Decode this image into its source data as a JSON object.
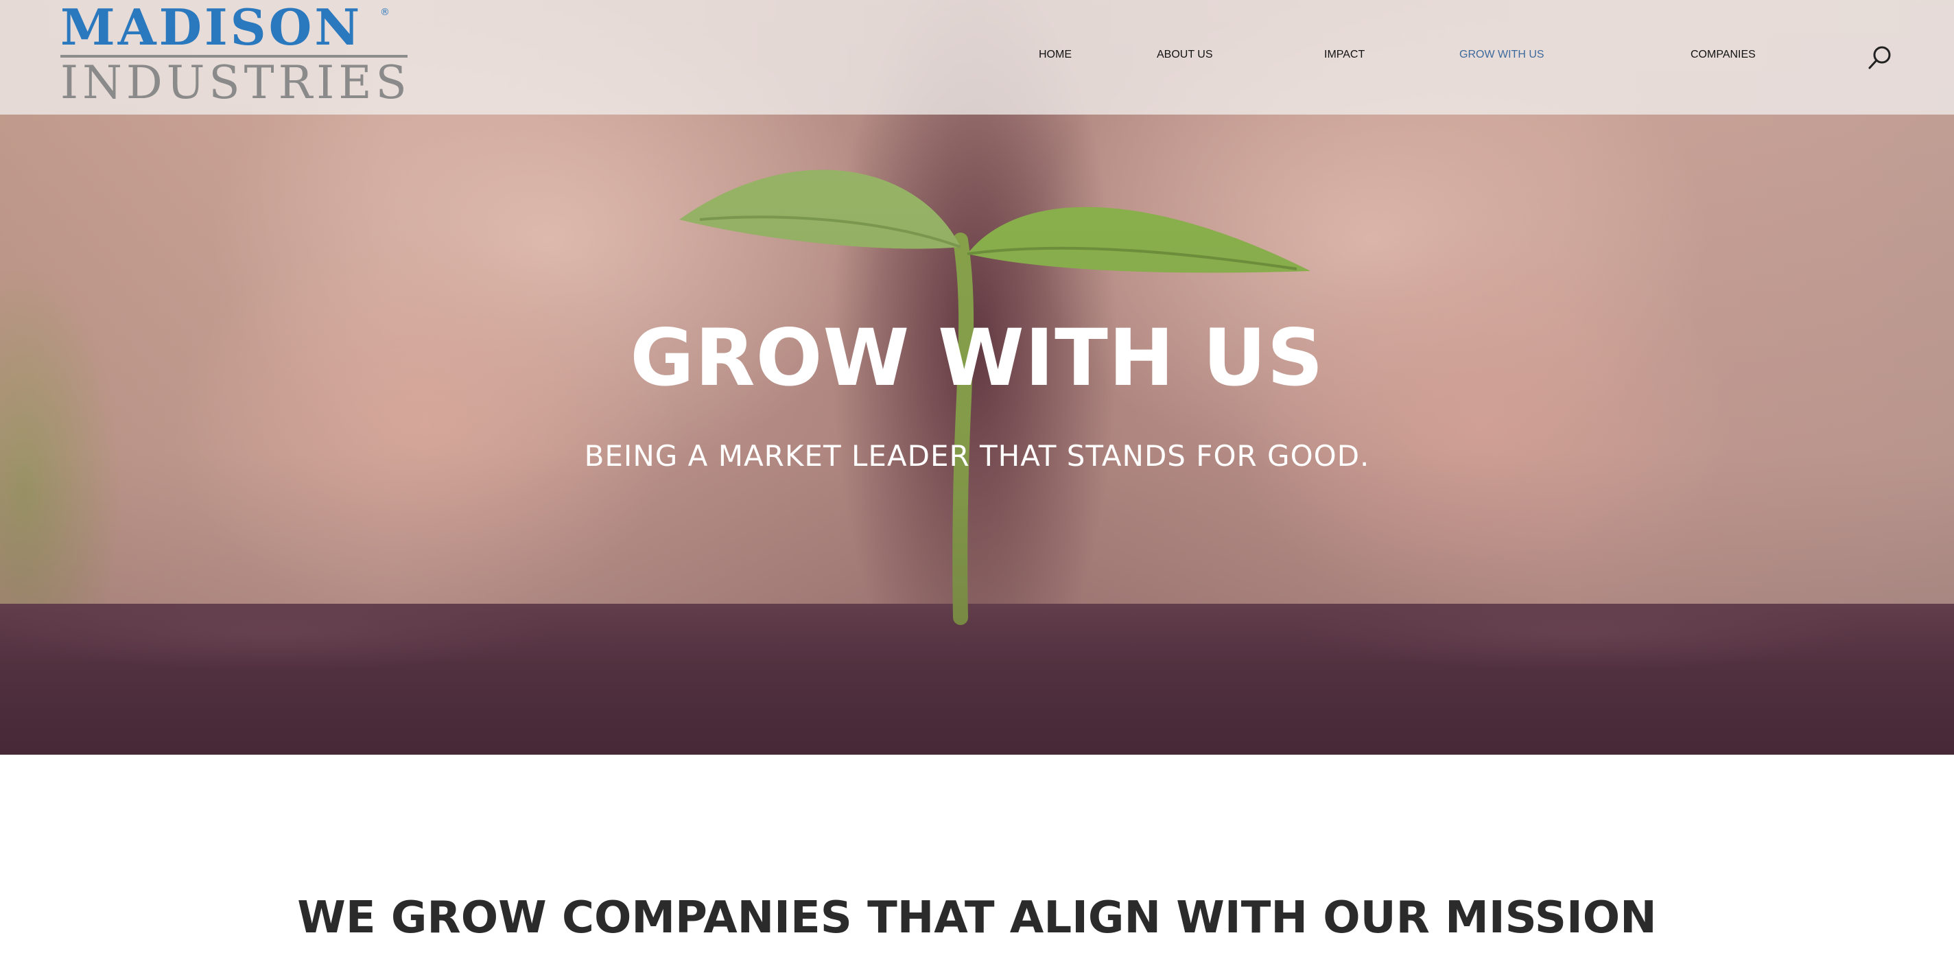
{
  "brand": {
    "name_top": "MADISON",
    "name_bottom": "INDUSTRIES",
    "registered_mark": "®",
    "colors": {
      "primary_blue": "#2a78be",
      "gray": "#8a8a8a"
    }
  },
  "nav": {
    "items": [
      {
        "label": "HOME",
        "active": false
      },
      {
        "label": "ABOUT US",
        "active": false
      },
      {
        "label": "IMPACT",
        "active": false
      },
      {
        "label": "GROW WITH US",
        "active": true
      },
      {
        "label": "COMPANIES",
        "active": false
      }
    ],
    "search_icon": "search-icon",
    "active_color": "#3d6a9c"
  },
  "hero": {
    "title": "GROW WITH US",
    "subtitle": "BEING A MARKET LEADER THAT STANDS FOR GOOD."
  },
  "main": {
    "heading": "WE GROW COMPANIES THAT ALIGN WITH OUR MISSION"
  }
}
